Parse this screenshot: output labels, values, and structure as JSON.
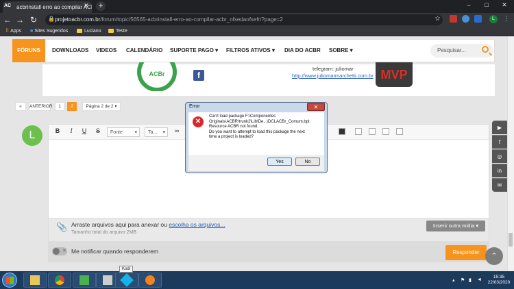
{
  "browser": {
    "tab_title": "acbrinstall erro ao compilar ACB...",
    "tab_logo": "AC",
    "url_host": "projetoacbr.com.br",
    "url_path": "/forum/topic/56565-acbrinstall-erro-ao-compilar-acbr_nfsedanfsefr/?page=2",
    "profile_initial": "L",
    "bookmarks": [
      "Apps",
      "Sites Sugeridos",
      "Luciano",
      "Teste"
    ]
  },
  "site_nav": {
    "items": [
      "FÓRUNS",
      "DOWNLOADS",
      "VIDEOS",
      "CALENDÁRIO",
      "SUPORTE PAGO",
      "FILTROS ATIVOS",
      "DIA DO ACBR",
      "SOBRE"
    ],
    "search_placeholder": "Pesquisar..."
  },
  "post": {
    "logo_text": "ACBr",
    "fb_letter": "f",
    "telegram": "telegram: juliomar",
    "site": "http://www.juliomarmarchetti.com.br",
    "mvp": "MVP"
  },
  "pagination": {
    "prev": "«",
    "prev_label": "ANTERIOR",
    "pages": [
      "1",
      "2"
    ],
    "page_of": "Página 2 de 2 ▾"
  },
  "reply": {
    "avatar_initial": "L",
    "font_select": "Fonte",
    "size_select": "Ta...",
    "attach_prefix": "Arraste arquivos aqui para anexar ou ",
    "attach_link": "escolha os arquivos...",
    "attach_size": "Tamanho total do arquivo 2MB",
    "insert_media": "Inserir outra mídia ▾",
    "notify": "Me notificar quando responderem",
    "submit": "Responder"
  },
  "dialog": {
    "title": "Error",
    "lines": [
      "Can't load package F:\\Componentes",
      "Originais\\ACBR\\trunk2\\Lib\\De...\\DCLACBr_Comum.bpl.",
      "Resource ACBR not found.",
      "Do you want to attempt to load this package the next",
      "time a project is loaded?"
    ],
    "yes": "Yes",
    "no": "No"
  },
  "taskbar": {
    "tooltip": "Kodi",
    "time": "15:35",
    "date": "22/03/2020"
  },
  "colors": {
    "accent": "#f7941d",
    "taskbar": "#1c3a5c"
  }
}
